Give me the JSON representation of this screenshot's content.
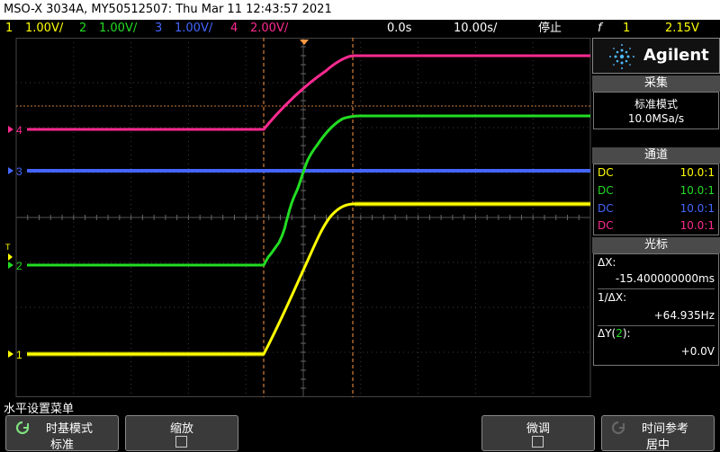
{
  "title_bar": "MSO-X 3034A, MY50512507: Thu Mar 11 12:43:57 2021",
  "channel_bar": {
    "ch1": {
      "num": "1",
      "scale": "1.00V/"
    },
    "ch2": {
      "num": "2",
      "scale": "1.00V/"
    },
    "ch3": {
      "num": "3",
      "scale": "1.00V/"
    },
    "ch4": {
      "num": "4",
      "scale": "2.00V/"
    },
    "delay": "0.0s",
    "timebase": "10.00s/",
    "run_state": "停止",
    "trigger_slope": "f",
    "trigger_channel": "1",
    "trigger_level": "2.15V"
  },
  "markers": {
    "ch1": "1",
    "ch2": "2",
    "ch3": "3",
    "ch4": "4",
    "trig": "T"
  },
  "colors": {
    "ch1": "#ffff00",
    "ch2": "#22dd22",
    "ch3": "#4466ff",
    "ch4": "#ff2a90",
    "cursor": "#ff9944"
  },
  "panel": {
    "brand": "Agilent",
    "acquire": {
      "heading": "采集",
      "mode": "标准模式",
      "rate": "10.0MSa/s"
    },
    "channels": {
      "heading": "通道",
      "rows": [
        {
          "coupling": "DC",
          "probe": "10.0:1"
        },
        {
          "coupling": "DC",
          "probe": "10.0:1"
        },
        {
          "coupling": "DC",
          "probe": "10.0:1"
        },
        {
          "coupling": "DC",
          "probe": "10.0:1"
        }
      ]
    },
    "cursors": {
      "heading": "光标",
      "dx_label": "ΔX:",
      "dx_value": "-15.400000000ms",
      "inv_label": "1/ΔX:",
      "inv_value": "+64.935Hz",
      "dy_label_prefix": "ΔY(",
      "dy_label_ch": "2",
      "dy_label_suffix": "):",
      "dy_value": "+0.0V"
    }
  },
  "menu_title": "水平设置菜单",
  "softkeys": {
    "timebase_mode": {
      "label": "时基模式",
      "value": "标准"
    },
    "zoom": {
      "label": "缩放"
    },
    "fine": {
      "label": "微调"
    },
    "time_ref": {
      "label": "时间参考",
      "value": "居中"
    }
  }
}
